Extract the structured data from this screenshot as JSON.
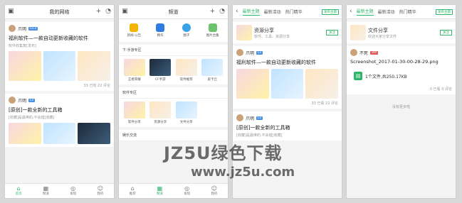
{
  "panel1": {
    "title": "我的网络",
    "post1": {
      "author": "爪明",
      "badge": "Lv.3",
      "title": "福利软件—一款自动更新收藏的软件",
      "subtitle": "软件收集复[发布]",
      "meta_left": "",
      "meta_right": "33 已有 22 评论"
    },
    "post2": {
      "author": "爪明",
      "title": "[原创]一款全新的工具箱",
      "subtitle": "[收藏]是最棒的,不会错[收藏]"
    },
    "tabs": [
      "首页",
      "频道",
      "发现",
      "我的"
    ]
  },
  "panel2": {
    "title": "频道",
    "quick": [
      "新闻·公告",
      "精华",
      "圈子",
      "图片合集"
    ],
    "section1": "下·手游专区",
    "games": [
      "王者荣耀",
      "CF手游",
      "软件推荐",
      "皮卡丘"
    ],
    "section2": "软件专区",
    "apps": [
      "软件分享",
      "资源分享",
      "文件分享"
    ],
    "section3": "娱乐交流",
    "tabs": [
      "推荐",
      "频道",
      "发现",
      "我的"
    ]
  },
  "panel3": {
    "tab_active": "最新主题",
    "tab2": "最新活动",
    "tab3": "热门精华",
    "chip": "发布主题",
    "group_name": "资源分享",
    "group_desc": "软件、工具、资源分享",
    "follow": "关注",
    "post1_author": "爪明",
    "post1_title": "福利软件—一款自动更新收藏的软件",
    "post1_meta": "33 已看 22 评论",
    "post2_author": "爪明",
    "post2_title": "[原创]一款全新的工具箱",
    "post2_subtitle": "[收藏]是最棒的,不会错[收藏]"
  },
  "panel4": {
    "tab_active": "最新主题",
    "tab2": "最新活动",
    "tab3": "热门精华",
    "chip": "发布主题",
    "group_name": "文件分享",
    "group_desc": "欢迎大家分享文件",
    "follow": "关注",
    "author": "不死",
    "file_name": "Screenshot_2017-01-30-00-28-29.png",
    "file_info": "1个文件,共250.17KB",
    "meta": "0 已看 0 评论",
    "footer": "没有更多啦"
  },
  "watermark": "JZ5U绿色下载",
  "watermark2": "www.jz5u.com"
}
